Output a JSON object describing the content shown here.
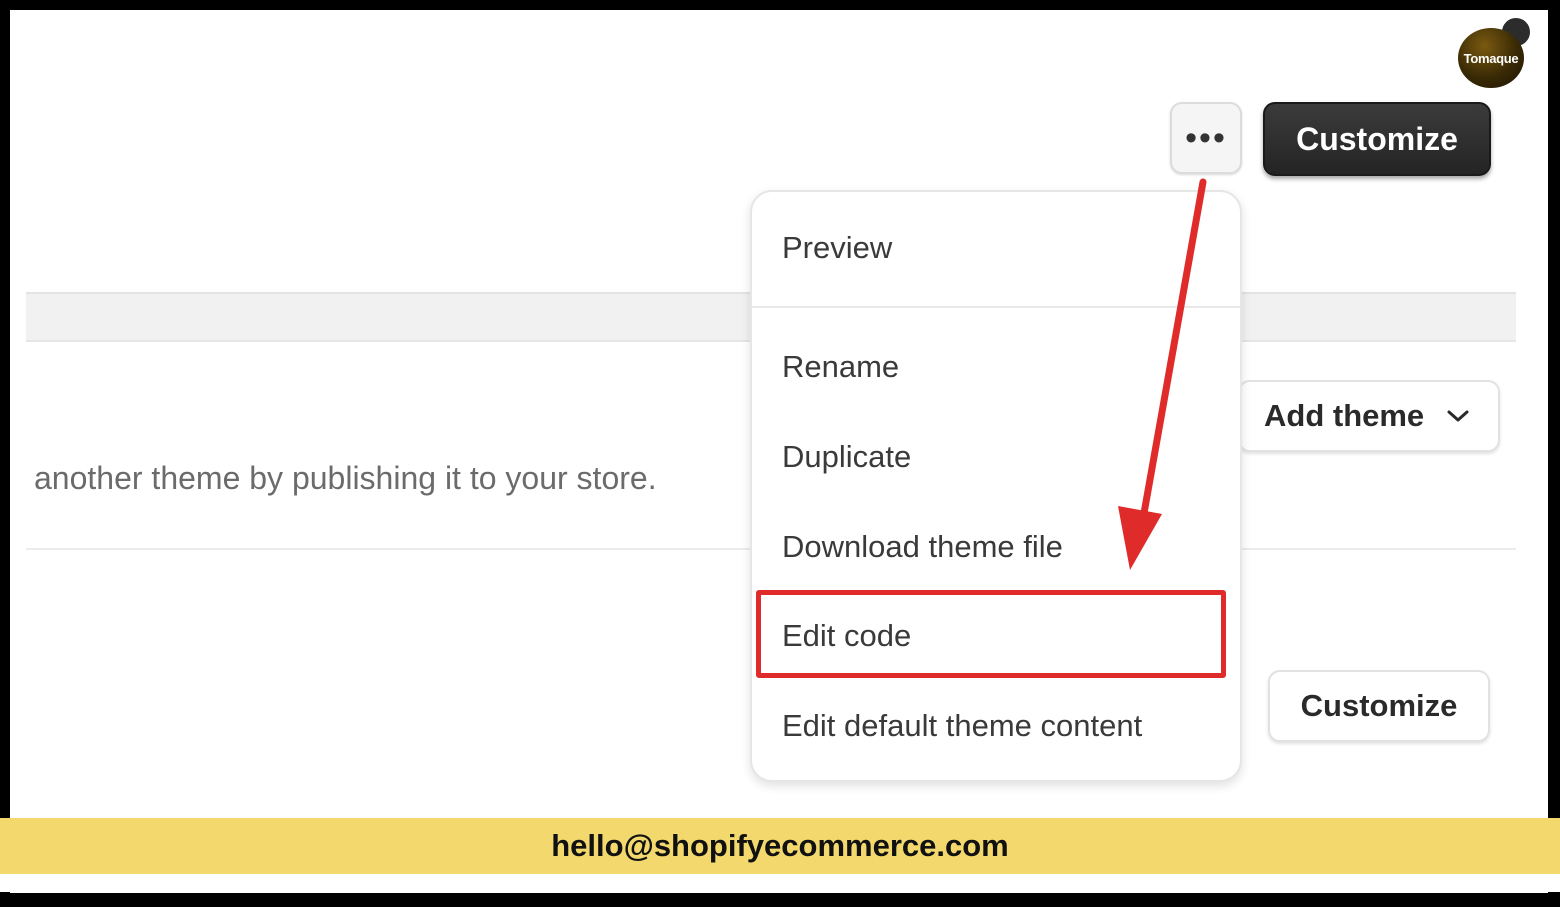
{
  "brand": {
    "logo_text": "Tomaque"
  },
  "header": {
    "more_glyph": "•••",
    "customize_label": "Customize"
  },
  "content": {
    "description": "another theme by publishing it to your store.",
    "add_theme_label": "Add theme",
    "customize_secondary_label": "Customize"
  },
  "menu": {
    "items": [
      {
        "label": "Preview"
      },
      {
        "label": "Rename"
      },
      {
        "label": "Duplicate"
      },
      {
        "label": "Download theme file"
      },
      {
        "label": "Edit code"
      },
      {
        "label": "Edit default theme content"
      }
    ],
    "highlighted_item": "Edit code"
  },
  "footer": {
    "email": "hello@shopifyecommerce.com"
  },
  "colors": {
    "annotation_red": "#e02b2b",
    "footer_yellow": "#f2d86d",
    "primary_button": "#2b2b2b"
  }
}
